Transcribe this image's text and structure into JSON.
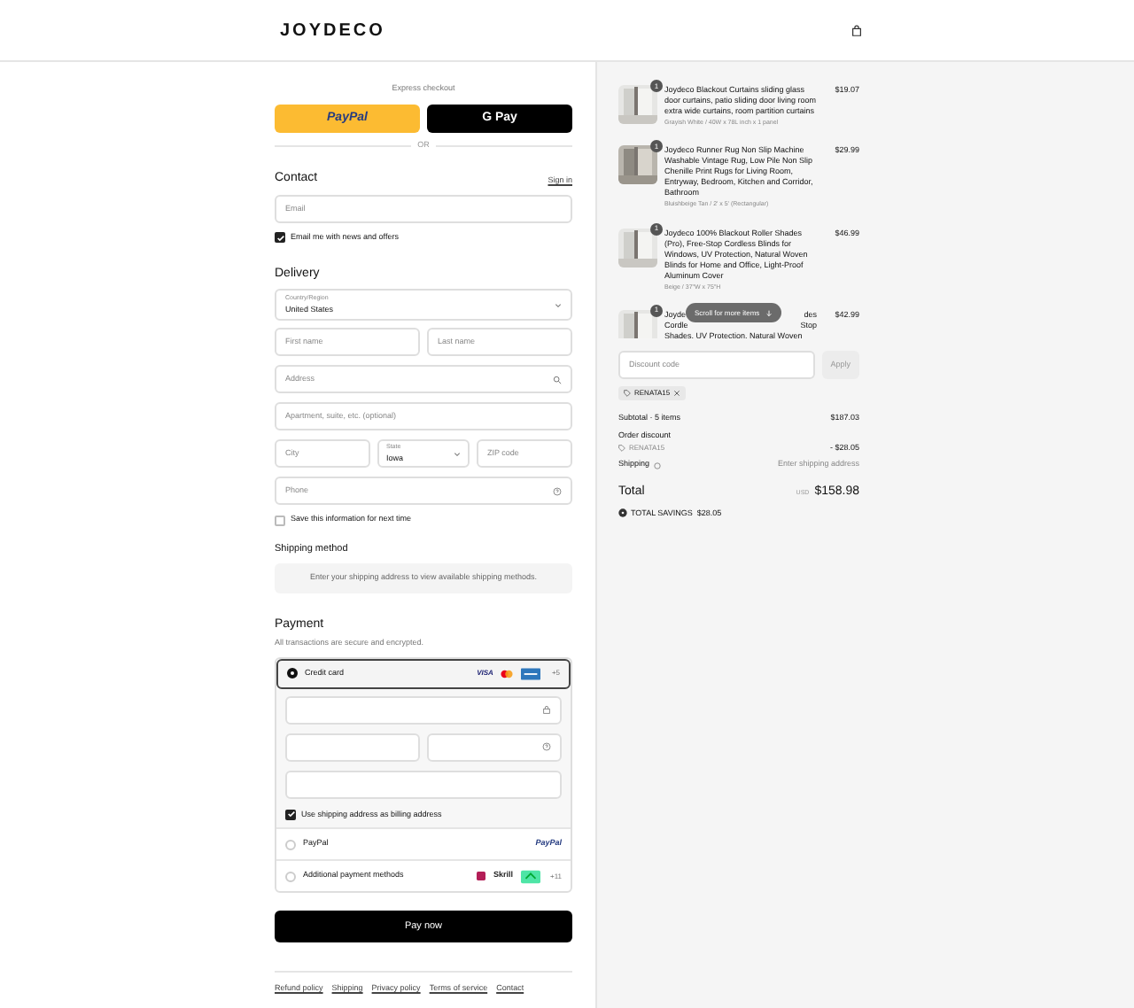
{
  "header": {
    "logo": "JOYDECO"
  },
  "express": {
    "title": "Express checkout",
    "buttons": [
      {
        "kind": "paypal",
        "label": "PayPal"
      },
      {
        "kind": "gpay",
        "label": "G Pay"
      }
    ],
    "divider": "OR"
  },
  "contact": {
    "title": "Contact",
    "link": "Sign in",
    "email": {
      "placeholder": "Email"
    },
    "news": {
      "label": "Email me with news and offers",
      "checked": true
    }
  },
  "delivery": {
    "title": "Delivery",
    "country": {
      "label": "Country/Region",
      "value": "United States"
    },
    "first_name": {
      "placeholder": "First name"
    },
    "last_name": {
      "placeholder": "Last name"
    },
    "address": {
      "placeholder": "Address"
    },
    "apartment": {
      "placeholder": "Apartment, suite, etc. (optional)"
    },
    "city": {
      "placeholder": "City"
    },
    "state": {
      "label": "State",
      "value": "Iowa"
    },
    "zip": {
      "placeholder": "ZIP code"
    },
    "phone": {
      "placeholder": "Phone"
    },
    "save": {
      "label": "Save this information for next time",
      "checked": false
    },
    "shipping_title": "Shipping method",
    "shipping_note": "Enter your shipping address to view available shipping methods."
  },
  "payment": {
    "title": "Payment",
    "subtitle": "All transactions are secure and encrypted.",
    "methods": [
      {
        "kind": "card",
        "label": "Credit card",
        "selected": true,
        "brands": [
          "VISA"
        ],
        "more": "+5"
      },
      {
        "kind": "paypal",
        "label": "PayPal",
        "selected": false,
        "brands": [
          "PayPal"
        ]
      },
      {
        "kind": "other",
        "label": "Additional payment methods",
        "selected": false,
        "brands": [
          "Skrill"
        ],
        "more": "+11"
      }
    ],
    "billing": {
      "label": "Use shipping address as billing address",
      "checked": true
    },
    "pay": "Pay now"
  },
  "footer_links": [
    "Refund policy",
    "Shipping",
    "Privacy policy",
    "Terms of service",
    "Contact"
  ],
  "summary": {
    "items": [
      {
        "qty": "1",
        "title": "Joydeco Blackout Curtains sliding glass door curtains, patio sliding door living room extra wide curtains, room partition curtains",
        "variant": "Grayish White / 40W x 78L inch x 1 panel",
        "price": "$19.07"
      },
      {
        "qty": "1",
        "title": "Joydeco Runner Rug Non Slip Machine Washable Vintage Rug, Low Pile Non Slip Chenille Print Rugs for Living Room, Entryway, Bedroom, Kitchen and Corridor, Bathroom",
        "variant": "Bluishbeige Tan / 2' x 5' (Rectangular)",
        "price": "$29.99"
      },
      {
        "qty": "1",
        "title": "Joydeco 100% Blackout Roller Shades (Pro), Free-Stop Cordless Blinds for Windows, UV Protection, Natural Woven Blinds for Home and Office, Light-Proof Aluminum Cover",
        "variant": "Beige / 37\"W x 75\"H",
        "price": "$46.99"
      },
      {
        "qty": "1",
        "fragments": [
          [
            "Joyde",
            "des"
          ],
          [
            "Cordle",
            "Stop"
          ],
          [
            "Shades, UV Protection, Natural Woven"
          ]
        ],
        "price": "$42.99"
      }
    ],
    "scroll_hint": "Scroll for more items",
    "discount": {
      "placeholder": "Discount code",
      "apply": "Apply",
      "tag": "RENATA15"
    },
    "subtotal_label": "Subtotal · 5 items",
    "subtotal": "$187.03",
    "order_discount_label": "Order discount",
    "order_discount_code": "RENATA15",
    "order_discount": "- $28.05",
    "shipping_label": "Shipping",
    "shipping_value": "Enter shipping address",
    "total_label": "Total",
    "currency": "USD",
    "total": "$158.98",
    "savings": "TOTAL SAVINGS  $28.05"
  }
}
